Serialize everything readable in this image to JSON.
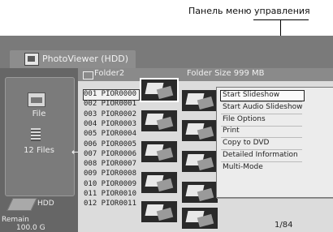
{
  "callout": {
    "label": "Панель меню управления"
  },
  "window": {
    "title": "PhotoViewer (HDD)"
  },
  "sidebar": {
    "file_label": "File",
    "files_count_label": "12 Files",
    "arrow": "←",
    "drive_label": "HDD",
    "remain_label": "Remain",
    "remain_value": "100.0 G"
  },
  "header": {
    "folder_name": "Folder2",
    "folder_size": "Folder Size 999 MB"
  },
  "files": [
    "001  PIOR0000",
    "002  PIOR0001",
    "003  PIOR0002",
    "004  PIOR0003",
    "005  PIOR0004",
    "006  PIOR0005",
    "007  PIOR0006",
    "008  PIOR0007",
    "009  PIOR0008",
    "010  PIOR0009",
    "011  PIOR0010",
    "012  PIOR0011"
  ],
  "selected_file_index": 0,
  "menu": {
    "items": [
      "Start Slideshow",
      "Start Audio Slideshow",
      "File Options",
      "Print",
      "Copy to DVD",
      "Detailed Information",
      "Multi-Mode"
    ],
    "highlighted_index": 0
  },
  "pager": {
    "text": "1/84"
  },
  "icons": [
    "folder-icon",
    "file-icon",
    "files-icon",
    "hdd-icon",
    "app-icon",
    "arrow-left-icon"
  ]
}
